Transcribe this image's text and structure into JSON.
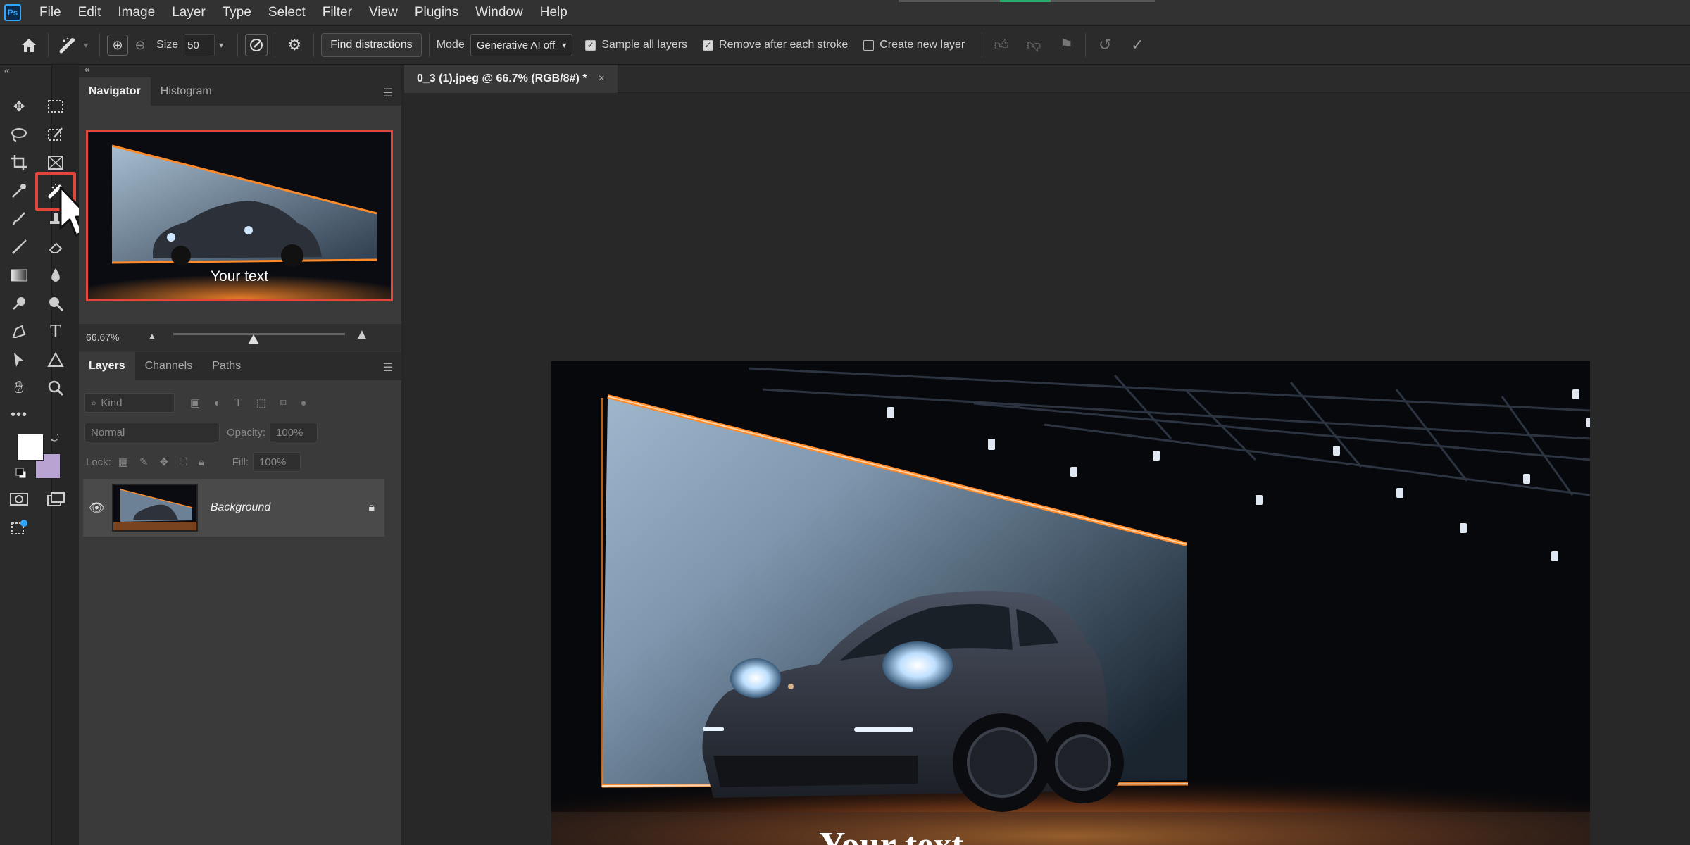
{
  "menu": {
    "logo": "Ps",
    "items": [
      "File",
      "Edit",
      "Image",
      "Layer",
      "Type",
      "Select",
      "Filter",
      "View",
      "Plugins",
      "Window",
      "Help"
    ]
  },
  "options": {
    "size_label": "Size",
    "size_value": "50",
    "find_distractions": "Find distractions",
    "mode_label": "Mode",
    "mode_value": "Generative AI off",
    "sample_all_layers": "Sample all layers",
    "sample_all_layers_checked": true,
    "remove_after_stroke": "Remove after each stroke",
    "remove_after_stroke_checked": true,
    "create_new_layer": "Create new layer",
    "create_new_layer_checked": false
  },
  "navigator": {
    "tabs": [
      "Navigator",
      "Histogram"
    ],
    "active_tab": "Navigator",
    "thumb_text": "Your text",
    "zoom": "66.67%"
  },
  "layers": {
    "tabs": [
      "Layers",
      "Channels",
      "Paths"
    ],
    "active_tab": "Layers",
    "kind_placeholder": "Kind",
    "blend_mode": "Normal",
    "opacity_label": "Opacity:",
    "opacity_value": "100%",
    "lock_label": "Lock:",
    "fill_label": "Fill:",
    "fill_value": "100%",
    "items": [
      {
        "name": "Background",
        "visible": true,
        "locked": true
      }
    ]
  },
  "document": {
    "tab_title": "0_3 (1).jpeg @ 66.7% (RGB/8#) *",
    "canvas_text": "Your text"
  },
  "colors": {
    "accent_highlight": "#e4453a",
    "foreground_swatch": "#ffffff",
    "background_swatch": "#b9a3d3",
    "neon_orange": "#ff8a2a"
  }
}
